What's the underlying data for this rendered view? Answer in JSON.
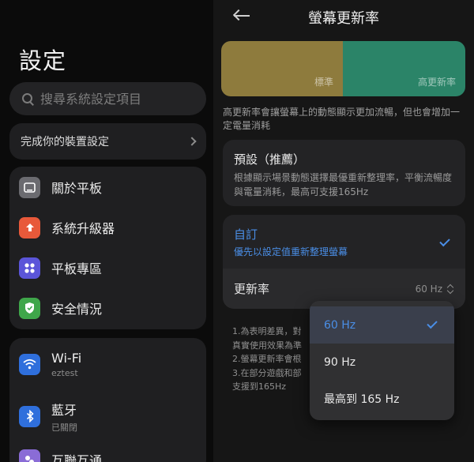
{
  "left": {
    "title": "設定",
    "search_placeholder": "搜尋系統設定項目",
    "setup_card": "完成你的裝置設定",
    "group1": [
      {
        "label": "關於平板",
        "icon": "tablet-icon",
        "color": "#6b6b70"
      },
      {
        "label": "系統升級器",
        "icon": "upload-arrow-icon",
        "color": "#e8593a"
      },
      {
        "label": "平板專區",
        "icon": "grid-dots-icon",
        "color": "#5b55d9"
      },
      {
        "label": "安全情況",
        "icon": "shield-check-icon",
        "color": "#3fa64a"
      }
    ],
    "group2": [
      {
        "label": "Wi-Fi",
        "sub": "eztest",
        "icon": "wifi-icon",
        "color": "#2f6fdc"
      },
      {
        "label": "藍牙",
        "sub": "已關閉",
        "icon": "bluetooth-icon",
        "color": "#2f6fdc"
      },
      {
        "label": "互聯互通",
        "icon": "connect-icon",
        "color": "#8a6cd6"
      }
    ]
  },
  "right": {
    "title": "螢幕更新率",
    "preview": {
      "standard_label": "標準",
      "high_label": "高更新率",
      "standard_color": "#8e7b3d",
      "high_color": "#2b8468"
    },
    "description": "高更新率會讓螢幕上的動態顯示更加流暢，但也會增加一定電量消耗",
    "default_option": {
      "title": "預設（推薦）",
      "desc": "根據顯示場景動態選擇最優重新整理率，平衡流暢度與電量消耗，最高可支援165Hz"
    },
    "custom_option": {
      "title": "自訂",
      "desc": "優先以設定值重新整理螢幕",
      "accent": "#4a8ee6"
    },
    "rate_row": {
      "label": "更新率",
      "value": "60 Hz"
    },
    "notes": [
      "1.為表明差異，對",
      "真實使用效果為準",
      "2.螢幕更新率會根",
      "3.在部分遊戲和部",
      "支援到165Hz"
    ]
  },
  "dropdown": {
    "options": [
      {
        "label": "60 Hz",
        "selected": true
      },
      {
        "label": "90 Hz",
        "selected": false
      },
      {
        "label": "最高到 165 Hz",
        "selected": false
      }
    ]
  }
}
